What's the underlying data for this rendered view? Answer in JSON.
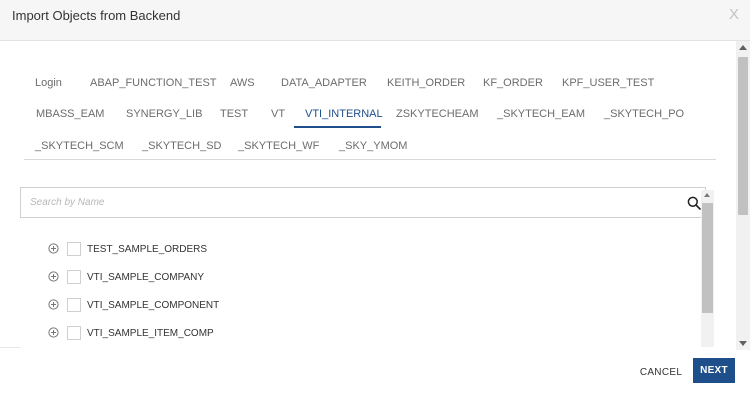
{
  "dialog": {
    "title": "Import Objects from Backend",
    "close_label": "X"
  },
  "tabs": [
    {
      "label": "Login"
    },
    {
      "label": "ABAP_FUNCTION_TEST"
    },
    {
      "label": "AWS"
    },
    {
      "label": "DATA_ADAPTER"
    },
    {
      "label": "KEITH_ORDER"
    },
    {
      "label": "KF_ORDER"
    },
    {
      "label": "KPF_USER_TEST"
    },
    {
      "label": "MBASS_EAM"
    },
    {
      "label": "SYNERGY_LIB"
    },
    {
      "label": "TEST"
    },
    {
      "label": "VT"
    },
    {
      "label": "VTI_INTERNAL"
    },
    {
      "label": "ZSKYTECHEAM"
    },
    {
      "label": "_SKYTECH_EAM"
    },
    {
      "label": "_SKYTECH_PO"
    },
    {
      "label": "_SKYTECH_SCM"
    },
    {
      "label": "_SKYTECH_SD"
    },
    {
      "label": "_SKYTECH_WF"
    },
    {
      "label": "_SKY_YMOM"
    }
  ],
  "active_tab": "VTI_INTERNAL",
  "search": {
    "placeholder": "Search by Name",
    "value": ""
  },
  "objects": [
    {
      "name": "TEST_SAMPLE_ORDERS",
      "checked": false
    },
    {
      "name": "VTI_SAMPLE_COMPANY",
      "checked": false
    },
    {
      "name": "VTI_SAMPLE_COMPONENT",
      "checked": false
    },
    {
      "name": "VTI_SAMPLE_ITEM_COMP",
      "checked": false
    }
  ],
  "footer": {
    "cancel_label": "CANCEL",
    "next_label": "NEXT"
  },
  "colors": {
    "accent": "#1f4f8a",
    "header_bg": "#f6f6f6",
    "tab_text": "#6c6c6c"
  },
  "icons": {
    "close": "close-icon",
    "search": "search-icon",
    "expand": "expand-plus-icon",
    "scroll_up": "scroll-up-arrow",
    "scroll_down": "scroll-down-arrow"
  }
}
